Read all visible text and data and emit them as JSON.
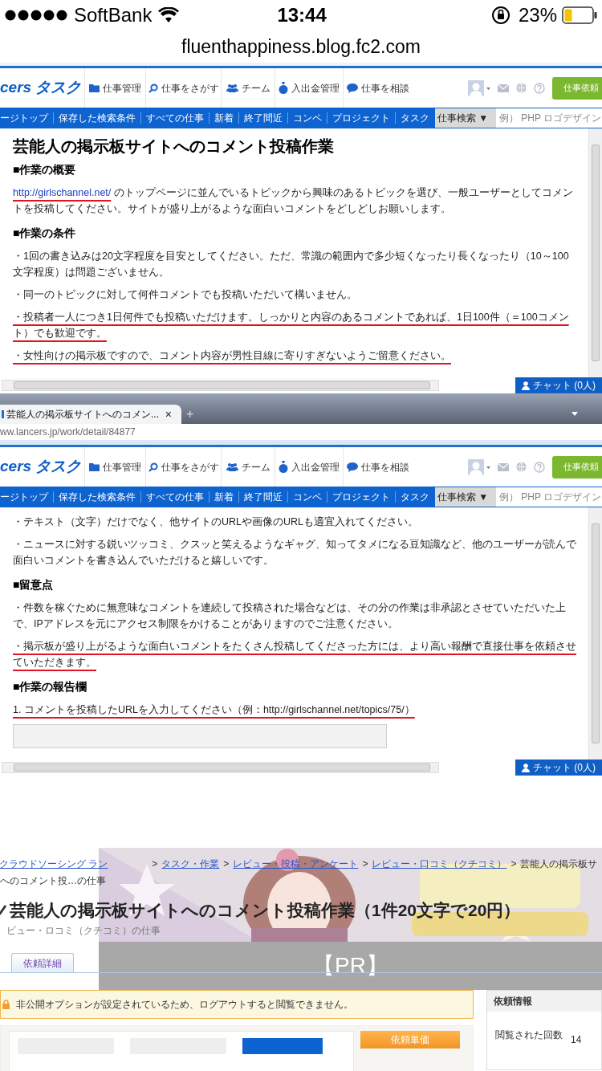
{
  "status_bar": {
    "carrier": "SoftBank",
    "time": "13:44",
    "battery": "23%"
  },
  "address_bar": {
    "url": "fluenthappiness.blog.fc2.com"
  },
  "shot_1": {
    "header": {
      "logo": "cers タスク",
      "menu": [
        "仕事管理",
        "仕事をさがす",
        "チーム",
        "入出金管理",
        "仕事を相談"
      ],
      "button": "仕事依頼"
    },
    "nav": {
      "links": [
        "ージトップ",
        "保存した検索条件",
        "すべての仕事",
        "新着",
        "終了間近",
        "コンペ",
        "プロジェクト",
        "タスク"
      ],
      "search_select": "仕事検索 ▼",
      "search_placeholder": "例） PHP ロゴデザイン"
    },
    "content": [
      {
        "kind": "title",
        "text": "芸能人の掲示板サイトへのコメント投稿作業"
      },
      {
        "kind": "heading",
        "text": "■作業の概要"
      },
      {
        "kind": "link_paragraph",
        "link": "http://girlschannel.net/",
        "text": " のトップページに並んでいるトピックから興味のあるトピックを選び、一般ユーザーとしてコメントを投稿してください。サイトが盛り上がるような面白いコメントをどしどしお願いします。",
        "marked": true
      },
      {
        "kind": "heading",
        "text": "■作業の条件"
      },
      {
        "kind": "paragraph",
        "text": "・1回の書き込みは20文字程度を目安としてください。ただ、常識の範囲内で多少短くなったり長くなったり（10～100文字程度）は問題ございません。",
        "marked": false
      },
      {
        "kind": "paragraph",
        "text": "・同一のトピックに対して何件コメントでも投稿いただいて構いません。",
        "marked": false
      },
      {
        "kind": "paragraph",
        "text": "・投稿者一人につき1日何件でも投稿いただけます。しっかりと内容のあるコメントであれば、1日100件（＝100コメント）でも歓迎です。",
        "marked": true
      },
      {
        "kind": "paragraph",
        "text": "・女性向けの掲示板ですので、コメント内容が男性目線に寄りすぎないようご留意ください。",
        "marked": true
      }
    ],
    "chat": "チャット (0人)"
  },
  "shot_2": {
    "tab": {
      "title": "芸能人の掲示板サイトへのコメン...",
      "close": "×",
      "new_tab": "+"
    },
    "url": "ww.lancers.jp/work/detail/84877",
    "header": {
      "logo": "cers タスク",
      "menu": [
        "仕事管理",
        "仕事をさがす",
        "チーム",
        "入出金管理",
        "仕事を相談"
      ],
      "button": "仕事依頼"
    },
    "nav": {
      "links": [
        "ージトップ",
        "保存した検索条件",
        "すべての仕事",
        "新着",
        "終了間近",
        "コンペ",
        "プロジェクト",
        "タスク"
      ],
      "search_select": "仕事検索 ▼",
      "search_placeholder": "例） PHP ロゴデザイン"
    },
    "content": [
      {
        "kind": "paragraph",
        "text": "・テキスト（文字）だけでなく、他サイトのURLや画像のURLも適宜入れてください。",
        "marked": false
      },
      {
        "kind": "paragraph",
        "text": "・ニュースに対する鋭いツッコミ、クスッと笑えるようなギャグ、知ってタメになる豆知識など、他のユーザーが読んで面白いコメントを書き込んでいただけると嬉しいです。",
        "marked": false
      },
      {
        "kind": "heading",
        "text": "■留意点"
      },
      {
        "kind": "paragraph",
        "text": "・件数を稼ぐために無意味なコメントを連続して投稿された場合などは、その分の作業は非承認とさせていただいた上で、IPアドレスを元にアクセス制限をかけることがありますのでご注意ください。",
        "marked": false
      },
      {
        "kind": "paragraph",
        "text": "・掲示板が盛り上がるような面白いコメントをたくさん投稿してくださった方には、より高い報酬で直接仕事を依頼させていただきます。",
        "marked": true
      },
      {
        "kind": "heading",
        "text": "■作業の報告欄"
      },
      {
        "kind": "paragraph",
        "text": "1. コメントを投稿したURLを入力してください（例：http://girlschannel.net/topics/75/）",
        "marked": true
      },
      {
        "kind": "field"
      }
    ],
    "chat": "チャット (0人)"
  },
  "shot_3": {
    "breadcrumb": [
      "クラウドソーシング ラン",
      "タスク・作業",
      "レビュー・投稿・アンケート",
      "レビュー・口コミ（クチコミ）"
    ],
    "breadcrumb_separator": ">",
    "breadcrumb_tail": "芸能人の掲示板サ",
    "breadcrumb_line2": "へのコメント投…の仕事",
    "title": "芸能人の掲示板サイトへのコメント投稿作業（1件20文字で20円）",
    "subtitle": "ビュー・ロコミ（クチコミ）の仕事",
    "ad": {
      "kind": "picture",
      "label": "【PR】"
    },
    "tab": "依頼詳細",
    "notice": "非公開オプションが設定されているため、ログアウトすると閲覧できません。",
    "side_panel": {
      "title": "依頼情報",
      "label": "閲覧された回数",
      "value": "14"
    },
    "button": "依頼単価"
  }
}
